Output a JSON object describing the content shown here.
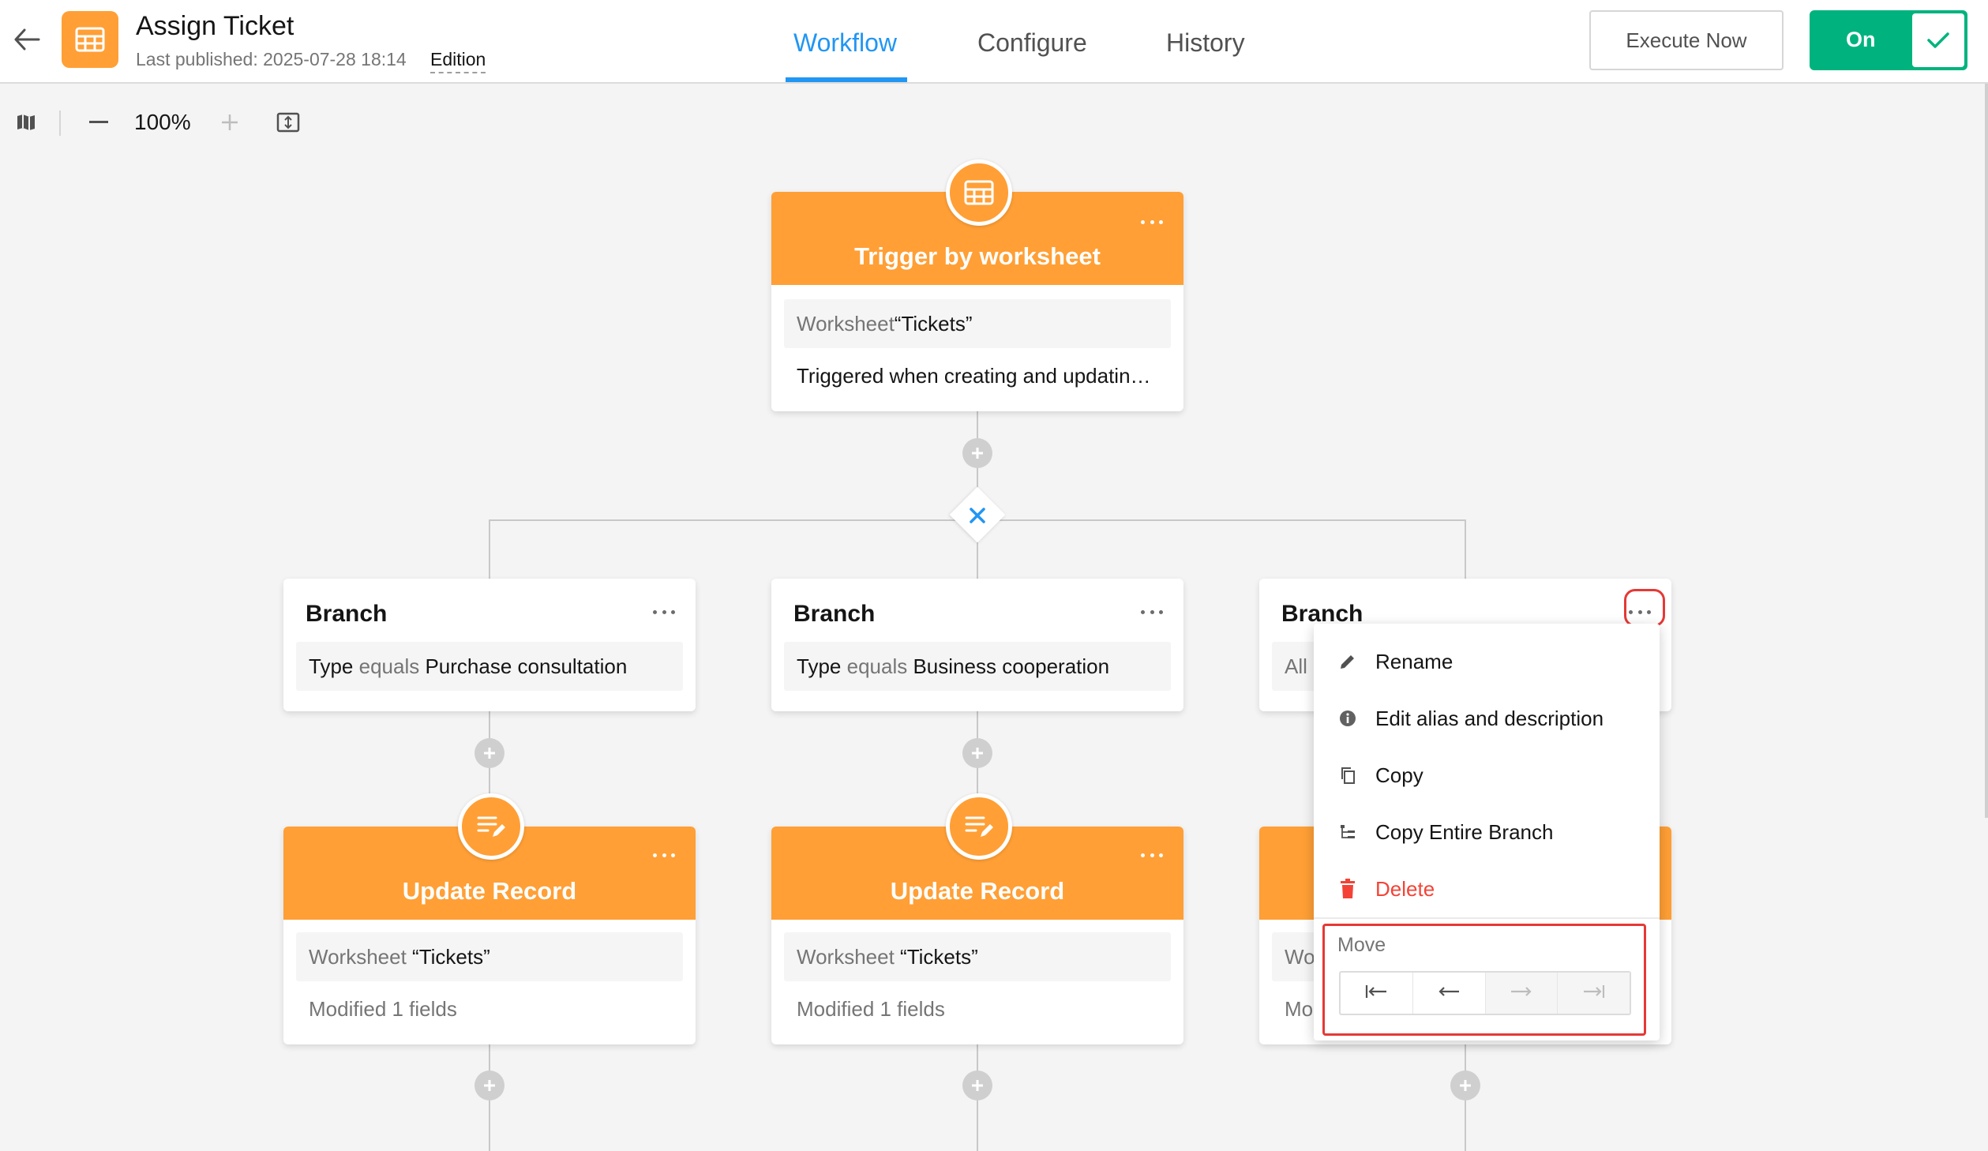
{
  "header": {
    "title": "Assign Ticket",
    "published": "Last published: 2025-07-28 18:14",
    "edition": "Edition",
    "tabs": [
      "Workflow",
      "Configure",
      "History"
    ],
    "active_tab": "Workflow",
    "execute_label": "Execute Now",
    "toggle_label": "On"
  },
  "toolbar": {
    "zoom": "100%"
  },
  "colors": {
    "accent": "#2196f3",
    "node_orange": "#ff9f35",
    "toggle_green": "#00b37e",
    "danger": "#f44336",
    "highlight": "#e53935"
  },
  "trigger": {
    "title": "Trigger by worksheet",
    "worksheet_prefix": "Worksheet",
    "worksheet_name": "“Tickets”",
    "description": "Triggered when creating and updatin…",
    "icon": "table-icon"
  },
  "branches": [
    {
      "title": "Branch",
      "field": "Type",
      "op": "equals",
      "value": "Purchase consultation"
    },
    {
      "title": "Branch",
      "field": "Type",
      "op": "equals",
      "value": "Business cooperation"
    },
    {
      "title": "Branch",
      "partial": "All"
    }
  ],
  "updates": [
    {
      "title": "Update Record",
      "worksheet_prefix": "Worksheet",
      "worksheet_name": "“Tickets”",
      "modified": "Modified 1 fields"
    },
    {
      "title": "Update Record",
      "worksheet_prefix": "Worksheet",
      "worksheet_name": "“Tickets”",
      "modified": "Modified 1 fields"
    },
    {
      "worksheet_partial": "Wo",
      "modified_partial": "Mo"
    }
  ],
  "menu": {
    "items": [
      {
        "label": "Rename",
        "icon": "pencil-icon"
      },
      {
        "label": "Edit alias and description",
        "icon": "info-icon"
      },
      {
        "label": "Copy",
        "icon": "copy-icon"
      },
      {
        "label": "Copy Entire Branch",
        "icon": "tree-icon"
      },
      {
        "label": "Delete",
        "icon": "trash-icon"
      }
    ],
    "move_label": "Move",
    "move_buttons": [
      {
        "name": "move-first",
        "icon": "arrow-to-start-icon"
      },
      {
        "name": "move-left",
        "icon": "arrow-left-icon"
      },
      {
        "name": "move-right",
        "icon": "arrow-right-icon"
      },
      {
        "name": "move-last",
        "icon": "arrow-to-end-icon"
      }
    ]
  }
}
